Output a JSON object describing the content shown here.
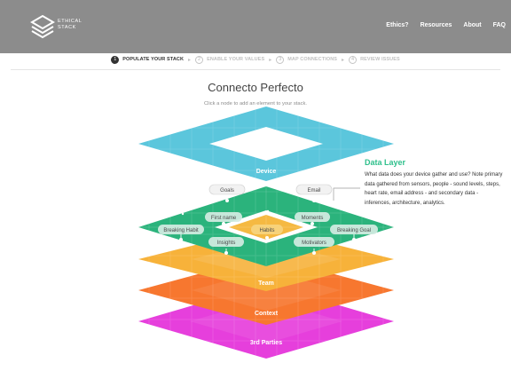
{
  "brand": {
    "line1": "ETHICAL",
    "line2": "STACK"
  },
  "nav": [
    {
      "label": "Ethics?"
    },
    {
      "label": "Resources"
    },
    {
      "label": "About"
    },
    {
      "label": "FAQ"
    }
  ],
  "steps": [
    {
      "num": "1",
      "label": "POPULATE YOUR STACK",
      "active": true
    },
    {
      "num": "2",
      "label": "ENABLE YOUR VALUES",
      "active": false
    },
    {
      "num": "3",
      "label": "MAP CONNECTIONS",
      "active": false
    },
    {
      "num": "4",
      "label": "REVIEW ISSUES",
      "active": false
    }
  ],
  "step_arrow": "▸",
  "title": "Connecto Perfecto",
  "subtitle": "Click a node to add an element to your stack.",
  "layers": {
    "device": "Device",
    "data": "",
    "team": "Team",
    "context": "Context",
    "third": "3rd Parties"
  },
  "colors": {
    "device": "#5bc6dc",
    "data": "#2bb37c",
    "team": "#f7b23a",
    "context": "#f7772f",
    "third": "#e63fdc",
    "highlight_node": "#f5b942",
    "accent": "#2fc08c"
  },
  "nodes": {
    "goals": "Goals",
    "email": "Email",
    "first_name": "First name",
    "moments": "Moments",
    "breaking_habit": "Breaking Habit",
    "habits": "Habits",
    "breaking_goal": "Breaking Goal",
    "insights": "Insights",
    "motivators": "Motivators"
  },
  "info": {
    "title": "Data Layer",
    "text": "What data does your device gather and use? Note primary data gathered from sensors, people - sound levels, steps, heart rate, email address - and secondary data - inferences, architecture, analytics."
  }
}
